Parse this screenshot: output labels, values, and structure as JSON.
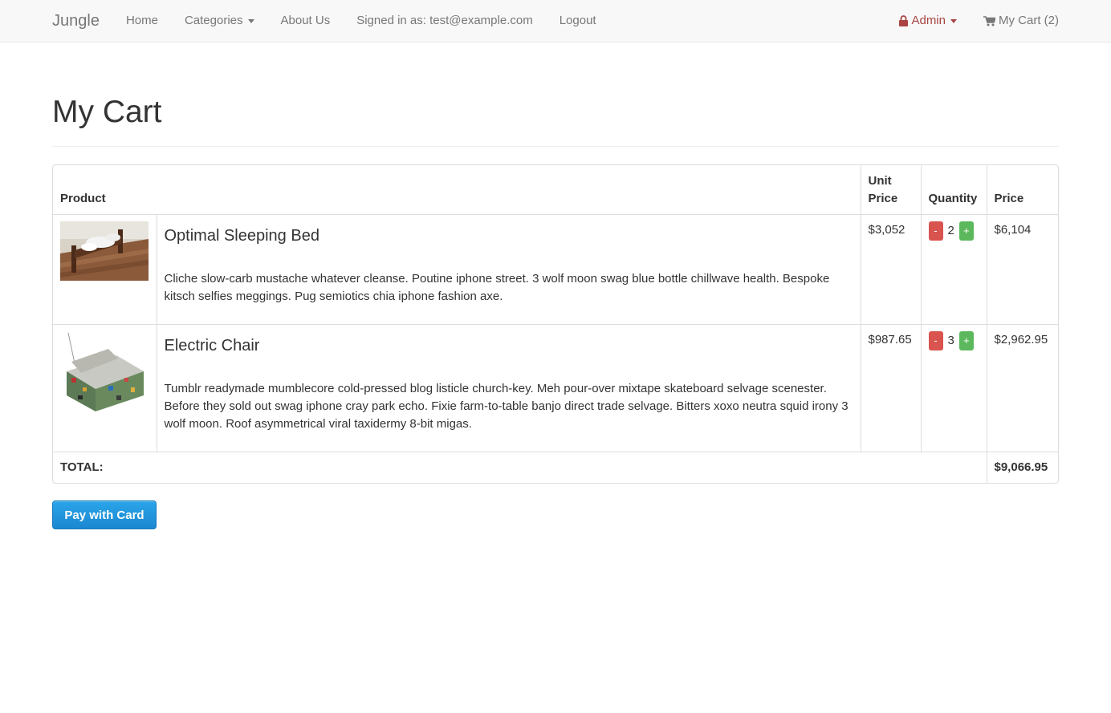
{
  "navbar": {
    "brand": "Jungle",
    "left_links": [
      {
        "label": "Home"
      },
      {
        "label": "Categories"
      },
      {
        "label": "About Us"
      },
      {
        "label": "Signed in as: test@example.com"
      },
      {
        "label": "Logout"
      }
    ],
    "admin_label": "Admin",
    "cart_label": "My Cart (2)",
    "admin_color": "#a94442"
  },
  "page": {
    "title": "My Cart"
  },
  "cart_table": {
    "headers": {
      "product": "Product",
      "unit_price": "Unit Price",
      "quantity": "Quantity",
      "price": "Price"
    },
    "items": [
      {
        "name": "Optimal Sleeping Bed",
        "description": "Cliche slow-carb mustache whatever cleanse. Poutine iphone street. 3 wolf moon swag blue bottle chillwave health. Bespoke kitsch selfies meggings. Pug semiotics chia iphone fashion axe.",
        "unit_price": "$3,052",
        "quantity": "2",
        "price": "$6,104",
        "minus_label": "-",
        "plus_label": "+"
      },
      {
        "name": "Electric Chair",
        "description": "Tumblr readymade mumblecore cold-pressed blog listicle church-key. Meh pour-over mixtape skateboard selvage scenester. Before they sold out swag iphone cray park echo. Fixie farm-to-table banjo direct trade selvage. Bitters xoxo neutra squid irony 3 wolf moon. Roof asymmetrical viral taxidermy 8-bit migas.",
        "unit_price": "$987.65",
        "quantity": "3",
        "price": "$2,962.95",
        "minus_label": "-",
        "plus_label": "+"
      }
    ],
    "total_label": "TOTAL:",
    "total_value": "$9,066.95"
  },
  "actions": {
    "pay_label": "Pay with Card"
  },
  "colors": {
    "minus": "#d9534f",
    "plus": "#5cb85c",
    "pay": "#1a87d1"
  }
}
